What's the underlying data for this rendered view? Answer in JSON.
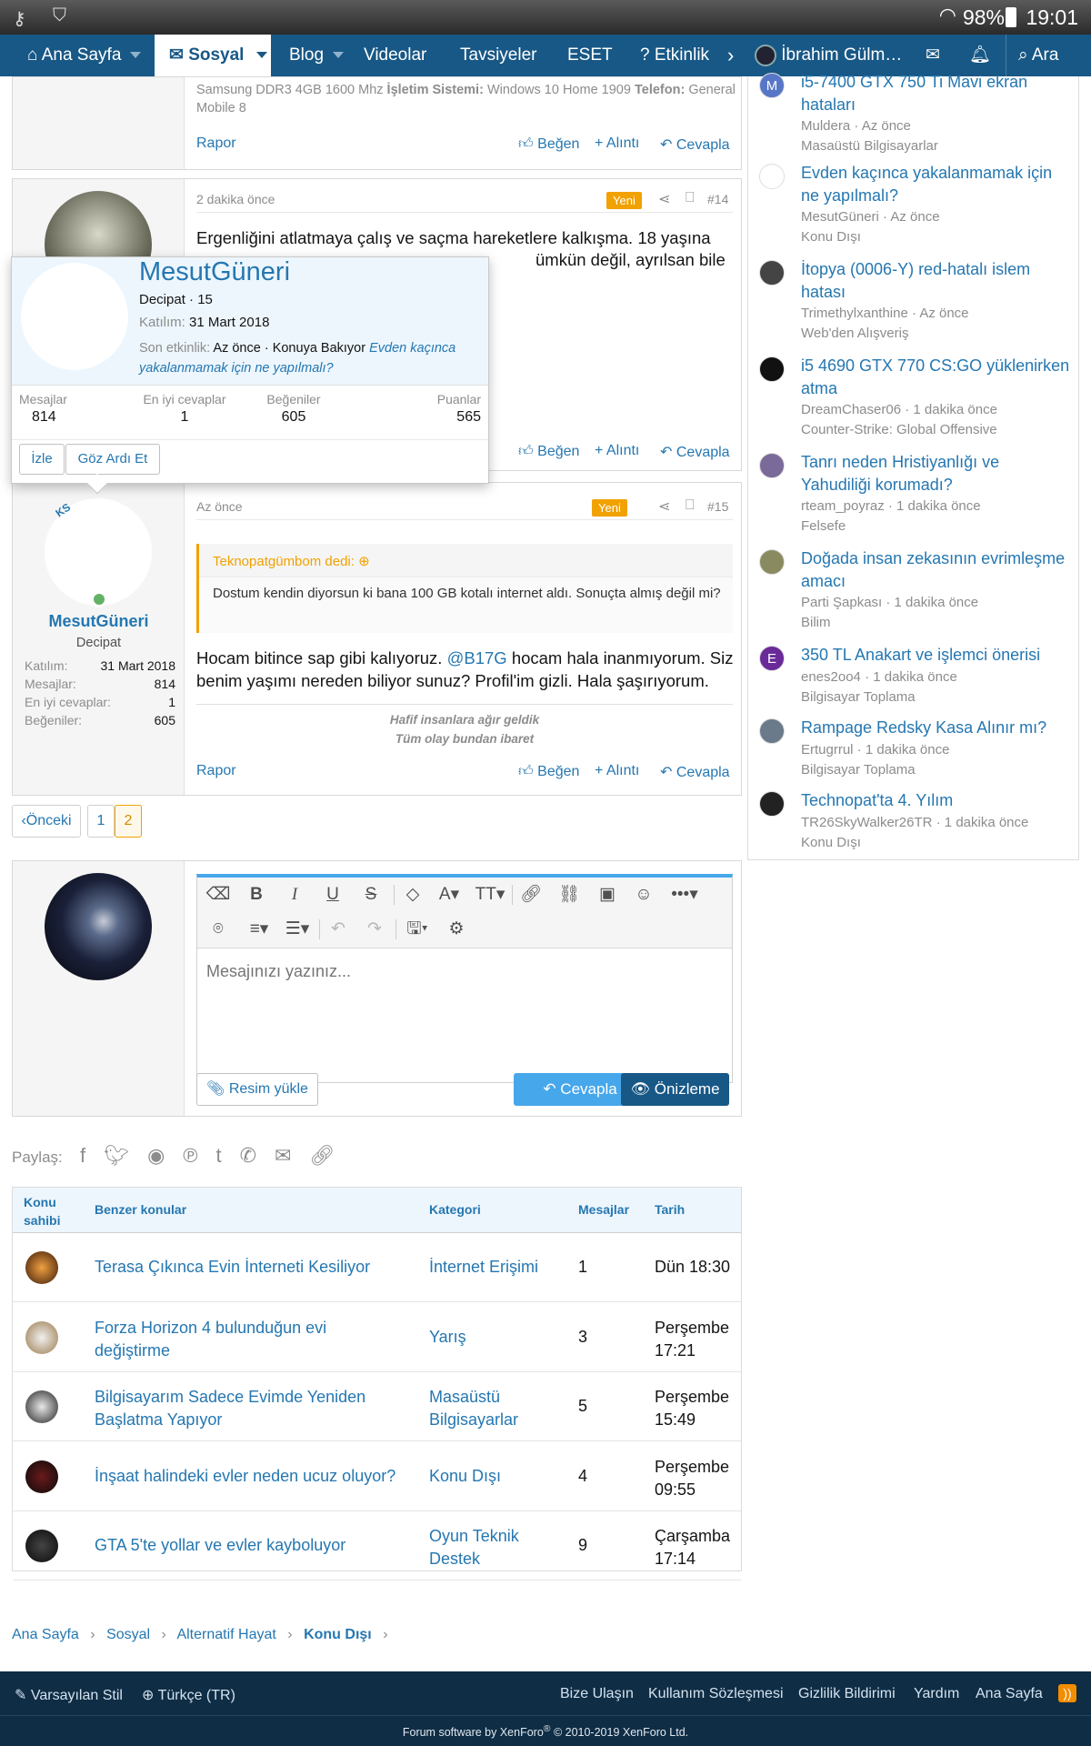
{
  "status_bar": {
    "battery": "98%",
    "time": "19:01"
  },
  "nav": {
    "home": "Ana Sayfa",
    "social": "Sosyal",
    "blog": "Blog",
    "videos": "Videolar",
    "recommendations": "Tavsiyeler",
    "eset": "ESET",
    "events": "Etkinlik",
    "user": "İbrahim Gülm…",
    "search": "Ara"
  },
  "post13": {
    "specs_line": "Samsung DDR3 4GB 1600 Mhz",
    "os_label": "İşletim Sistemi:",
    "os_value": "Windows 10 Home 1909",
    "phone_label": "Telefon:",
    "phone_value": "General Mobile 8",
    "report": "Rapor",
    "like": "Beğen",
    "quote": "Alıntı",
    "reply": "Cevapla"
  },
  "post14": {
    "time": "2 dakika önce",
    "new": "Yeni",
    "number": "#14",
    "line1": "Ergenliğini atlatmaya çalış ve saçma hareketlere kalkışma. 18 yaşına",
    "line2": "ümkün değil, ayrılsan bile",
    "like": "Beğen",
    "quote": "Alıntı",
    "reply": "Cevapla"
  },
  "popup": {
    "name": "MesutGüneri",
    "title": "Decipat · 15",
    "joined_label": "Katılım:",
    "joined_value": "31 Mart 2018",
    "last_label": "Son etkinlik:",
    "last_value": "Az önce · Konuya Bakıyor",
    "last_thread": "Evden kaçınca yakalanmamak için ne yapılmalı?",
    "stats": [
      {
        "label": "Mesajlar",
        "value": "814"
      },
      {
        "label": "En iyi cevaplar",
        "value": "1"
      },
      {
        "label": "Beğeniler",
        "value": "605"
      },
      {
        "label": "Puanlar",
        "value": "565"
      }
    ],
    "follow": "İzle",
    "ignore": "Göz Ardı Et"
  },
  "post15": {
    "time": "Az önce",
    "new": "Yeni",
    "number": "#15",
    "user": "MesutGüneri",
    "user_title": "Decipat",
    "avatar_initials": "KS",
    "info": [
      {
        "label": "Katılım:",
        "value": "31 Mart 2018"
      },
      {
        "label": "Mesajlar:",
        "value": "814"
      },
      {
        "label": "En iyi cevaplar:",
        "value": "1"
      },
      {
        "label": "Beğeniler:",
        "value": "605"
      }
    ],
    "quote_author": "Teknopatgümbom dedi:",
    "quote_text": "Dostum kendin diyorsun ki bana 100 GB kotalı internet aldı. Sonuçta almış değil mi?",
    "text_a": "Hocam bitince sap gibi kalıyoruz.",
    "mention": "@B17G",
    "text_b": "hocam hala inanmıyorum. Siz",
    "text_c": "benim yaşımı nereden biliyor sunuz? Profil'im gizli. Hala şaşırıyorum.",
    "sig1": "Hafif insanlara ağır geldik",
    "sig2": "Tüm olay bundan ibaret",
    "report": "Rapor",
    "like": "Beğen",
    "quote": "Alıntı",
    "reply": "Cevapla"
  },
  "pagination": {
    "prev": "Önceki",
    "pages": [
      "1",
      "2"
    ]
  },
  "editor": {
    "placeholder": "Mesajınızı yazınız...",
    "upload": "Resim yükle",
    "reply": "Cevapla",
    "preview": "Önizleme"
  },
  "share": {
    "label": "Paylaş:"
  },
  "similar": {
    "headers": {
      "owner": "Konu sahibi",
      "thread": "Benzer konular",
      "category": "Kategori",
      "messages": "Mesajlar",
      "date": "Tarih"
    },
    "rows": [
      {
        "title1": "Terasa Çıkınca Evin İnterneti Kesiliyor",
        "title2": "",
        "cat1": "İnternet Erişimi",
        "cat2": "",
        "msgs": "1",
        "date1": "Dün 18:30",
        "date2": ""
      },
      {
        "title1": "Forza Horizon 4 bulunduğun evi",
        "title2": "değiştirme",
        "cat1": "Yarış",
        "cat2": "",
        "msgs": "3",
        "date1": "Perşembe",
        "date2": "17:21"
      },
      {
        "title1": "Bilgisayarım Sadece Evimde Yeniden",
        "title2": "Başlatma Yapıyor",
        "cat1": "Masaüstü",
        "cat2": "Bilgisayarlar",
        "msgs": "5",
        "date1": "Perşembe",
        "date2": "15:49"
      },
      {
        "title1": "İnşaat halindeki evler neden ucuz oluyor?",
        "title2": "",
        "cat1": "Konu Dışı",
        "cat2": "",
        "msgs": "4",
        "date1": "Perşembe",
        "date2": "09:55"
      },
      {
        "title1": "GTA 5'te yollar ve evler kayboluyor",
        "title2": "",
        "cat1": "Oyun Teknik",
        "cat2": "Destek",
        "msgs": "9",
        "date1": "Çarşamba",
        "date2": "17:14"
      }
    ]
  },
  "breadcrumb": [
    "Ana Sayfa",
    "Sosyal",
    "Alternatif Hayat",
    "Konu Dışı"
  ],
  "footer": {
    "style": "Varsayılan Stil",
    "language": "Türkçe (TR)",
    "links": [
      "Bize Ulaşın",
      "Kullanım Sözleşmesi",
      "Gizlilik Bildirimi",
      "Yardım",
      "Ana Sayfa"
    ],
    "copyright_a": "Forum software by XenForo",
    "copyright_b": "© 2010-2019 XenForo Ltd."
  },
  "sidebar": {
    "items": [
      {
        "t1": "i5-7400 GTX 750 Ti Mavi ekran",
        "t2": "hataları",
        "s1": "Muldera · Az önce",
        "s2": "Masaüstü Bilgisayarlar",
        "letter": "M",
        "color": "#5876c8"
      },
      {
        "t1": "Evden kaçınca yakalanmamak için",
        "t2": "ne yapılmalı?",
        "s1": "MesutGüneri · Az önce",
        "s2": "Konu Dışı",
        "letter": "",
        "color": "#ffffff"
      },
      {
        "t1": "İtopya (0006-Y) red-hatalı islem",
        "t2": "hatası",
        "s1": "Trimethylxanthine · Az önce",
        "s2": "Web'den Alışveriş",
        "letter": "",
        "color": "#444444"
      },
      {
        "t1": "i5 4690 GTX 770 CS:GO yüklenirken",
        "t2": "atma",
        "s1": "DreamChaser06 · 1 dakika önce",
        "s2": "Counter-Strike: Global Offensive",
        "letter": "",
        "color": "#111111"
      },
      {
        "t1": "Tanrı neden Hristiyanlığı ve",
        "t2": "Yahudiliği korumadı?",
        "s1": "rteam_poyraz · 1 dakika önce",
        "s2": "Felsefe",
        "letter": "",
        "color": "#7a6a9a"
      },
      {
        "t1": "Doğada insan zekasının evrimleşme",
        "t2": "amacı",
        "s1": "Parti Şapkası · 1 dakika önce",
        "s2": "Bilim",
        "letter": "",
        "color": "#8a8a60"
      },
      {
        "t1": "350 TL Anakart ve işlemci önerisi",
        "t2": "",
        "s1": "enes2oo4 · 1 dakika önce",
        "s2": "Bilgisayar Toplama",
        "letter": "E",
        "color": "#6a2a9a"
      },
      {
        "t1": "Rampage Redsky Kasa Alınır mı?",
        "t2": "",
        "s1": "Ertugrrul · 1 dakika önce",
        "s2": "Bilgisayar Toplama",
        "letter": "",
        "color": "#6a7a8a"
      },
      {
        "t1": "Technopat'ta 4. Yılım",
        "t2": "",
        "s1": "TR26SkyWalker26TR · 1 dakika önce",
        "s2": "Konu Dışı",
        "letter": "",
        "color": "#222222"
      }
    ]
  }
}
